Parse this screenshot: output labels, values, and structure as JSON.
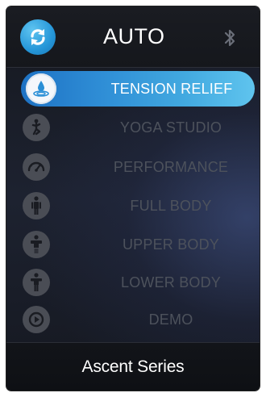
{
  "header": {
    "title": "AUTO",
    "sync_icon": "sync-icon",
    "bluetooth_icon": "bluetooth-icon"
  },
  "menu": {
    "items": [
      {
        "label": "TENSION RELIEF",
        "icon": "water-drop-icon",
        "active": true
      },
      {
        "label": "YOGA STUDIO",
        "icon": "yoga-pose-icon",
        "active": false
      },
      {
        "label": "PERFORMANCE",
        "icon": "speedometer-icon",
        "active": false
      },
      {
        "label": "FULL BODY",
        "icon": "full-body-icon",
        "active": false
      },
      {
        "label": "UPPER BODY",
        "icon": "upper-body-icon",
        "active": false
      },
      {
        "label": "LOWER BODY",
        "icon": "lower-body-icon",
        "active": false
      },
      {
        "label": "DEMO",
        "icon": "play-icon",
        "active": false
      }
    ]
  },
  "footer": {
    "title": "Ascent Series"
  },
  "colors": {
    "accent_start": "#1e72c4",
    "accent_end": "#5fc4ee",
    "inactive_text": "#4d525c",
    "inactive_icon": "#4a4d55"
  }
}
